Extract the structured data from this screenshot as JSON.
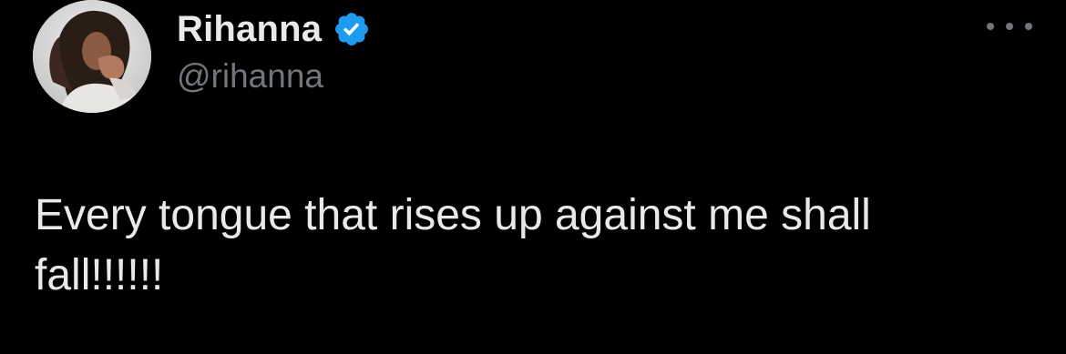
{
  "tweet": {
    "author": {
      "display_name": "Rihanna",
      "handle": "@rihanna",
      "verified": true,
      "avatar_icon": "profile-photo",
      "badge_icon": "verified-badge-icon",
      "badge_color": "#1d9bf0"
    },
    "more_icon": "more-horizontal-icon",
    "text": "Every tongue that rises up against me shall fall!!!!!!"
  },
  "colors": {
    "background": "#000000",
    "primary_text": "#e7e9ea",
    "secondary_text": "#71767b"
  }
}
